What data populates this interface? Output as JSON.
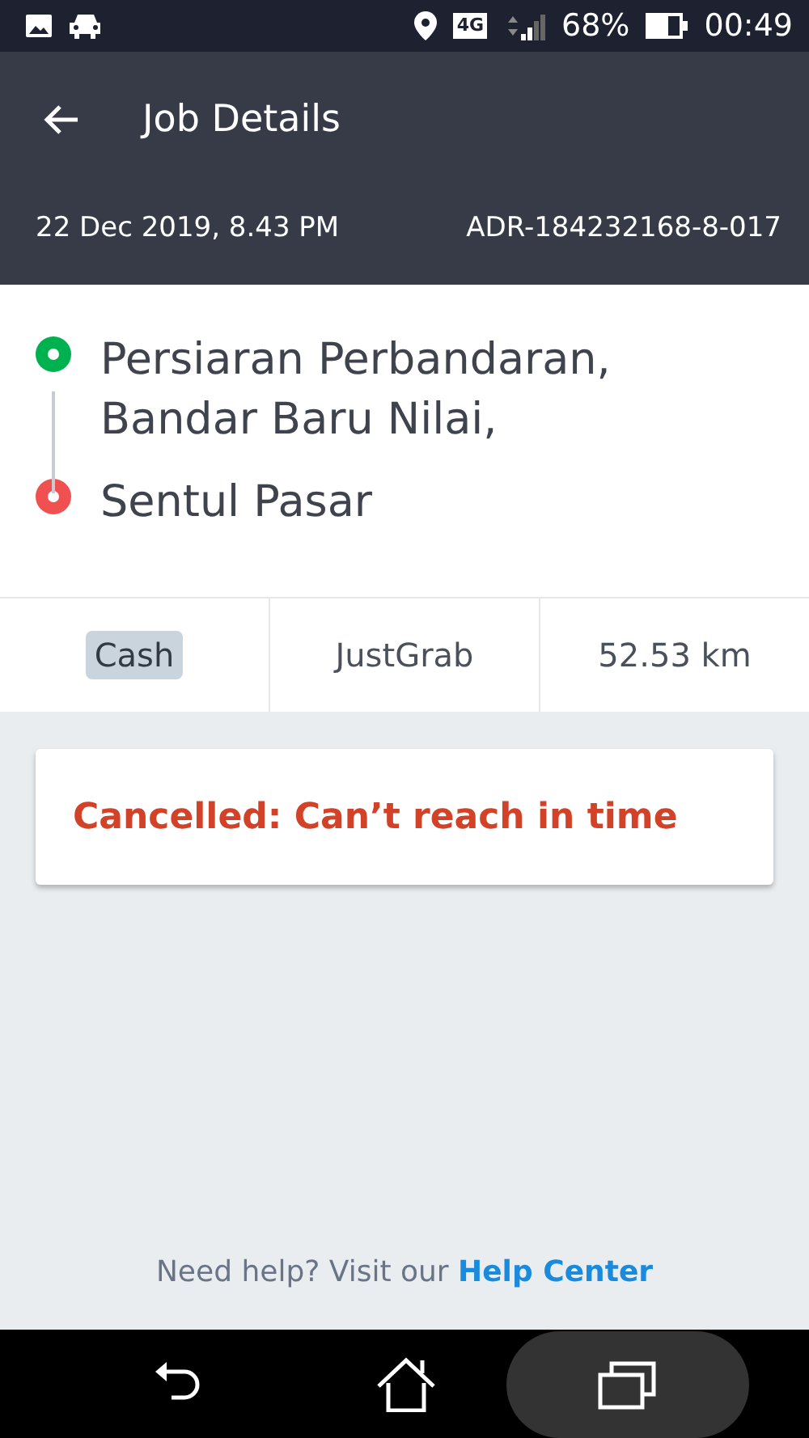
{
  "status_bar": {
    "network": "4G",
    "battery": "68%",
    "time": "00:49"
  },
  "header": {
    "title": "Job Details",
    "date": "22 Dec 2019, 8.43 PM",
    "booking_id": "ADR-184232168-8-017"
  },
  "stops": [
    {
      "text": "Persiaran Perbandaran, Bandar Baru Nilai,",
      "color": "#00b14f"
    },
    {
      "text": "Sentul Pasar",
      "color": "#f0504f"
    }
  ],
  "info": [
    {
      "text": "Cash",
      "highlighted": true
    },
    {
      "text": "JustGrab",
      "highlighted": false
    },
    {
      "text": "52.53 km",
      "highlighted": false
    }
  ],
  "status_card": {
    "text": "Cancelled: Can’t reach in time"
  },
  "help": {
    "text": "Need help? Visit our",
    "link": "Help Center"
  }
}
